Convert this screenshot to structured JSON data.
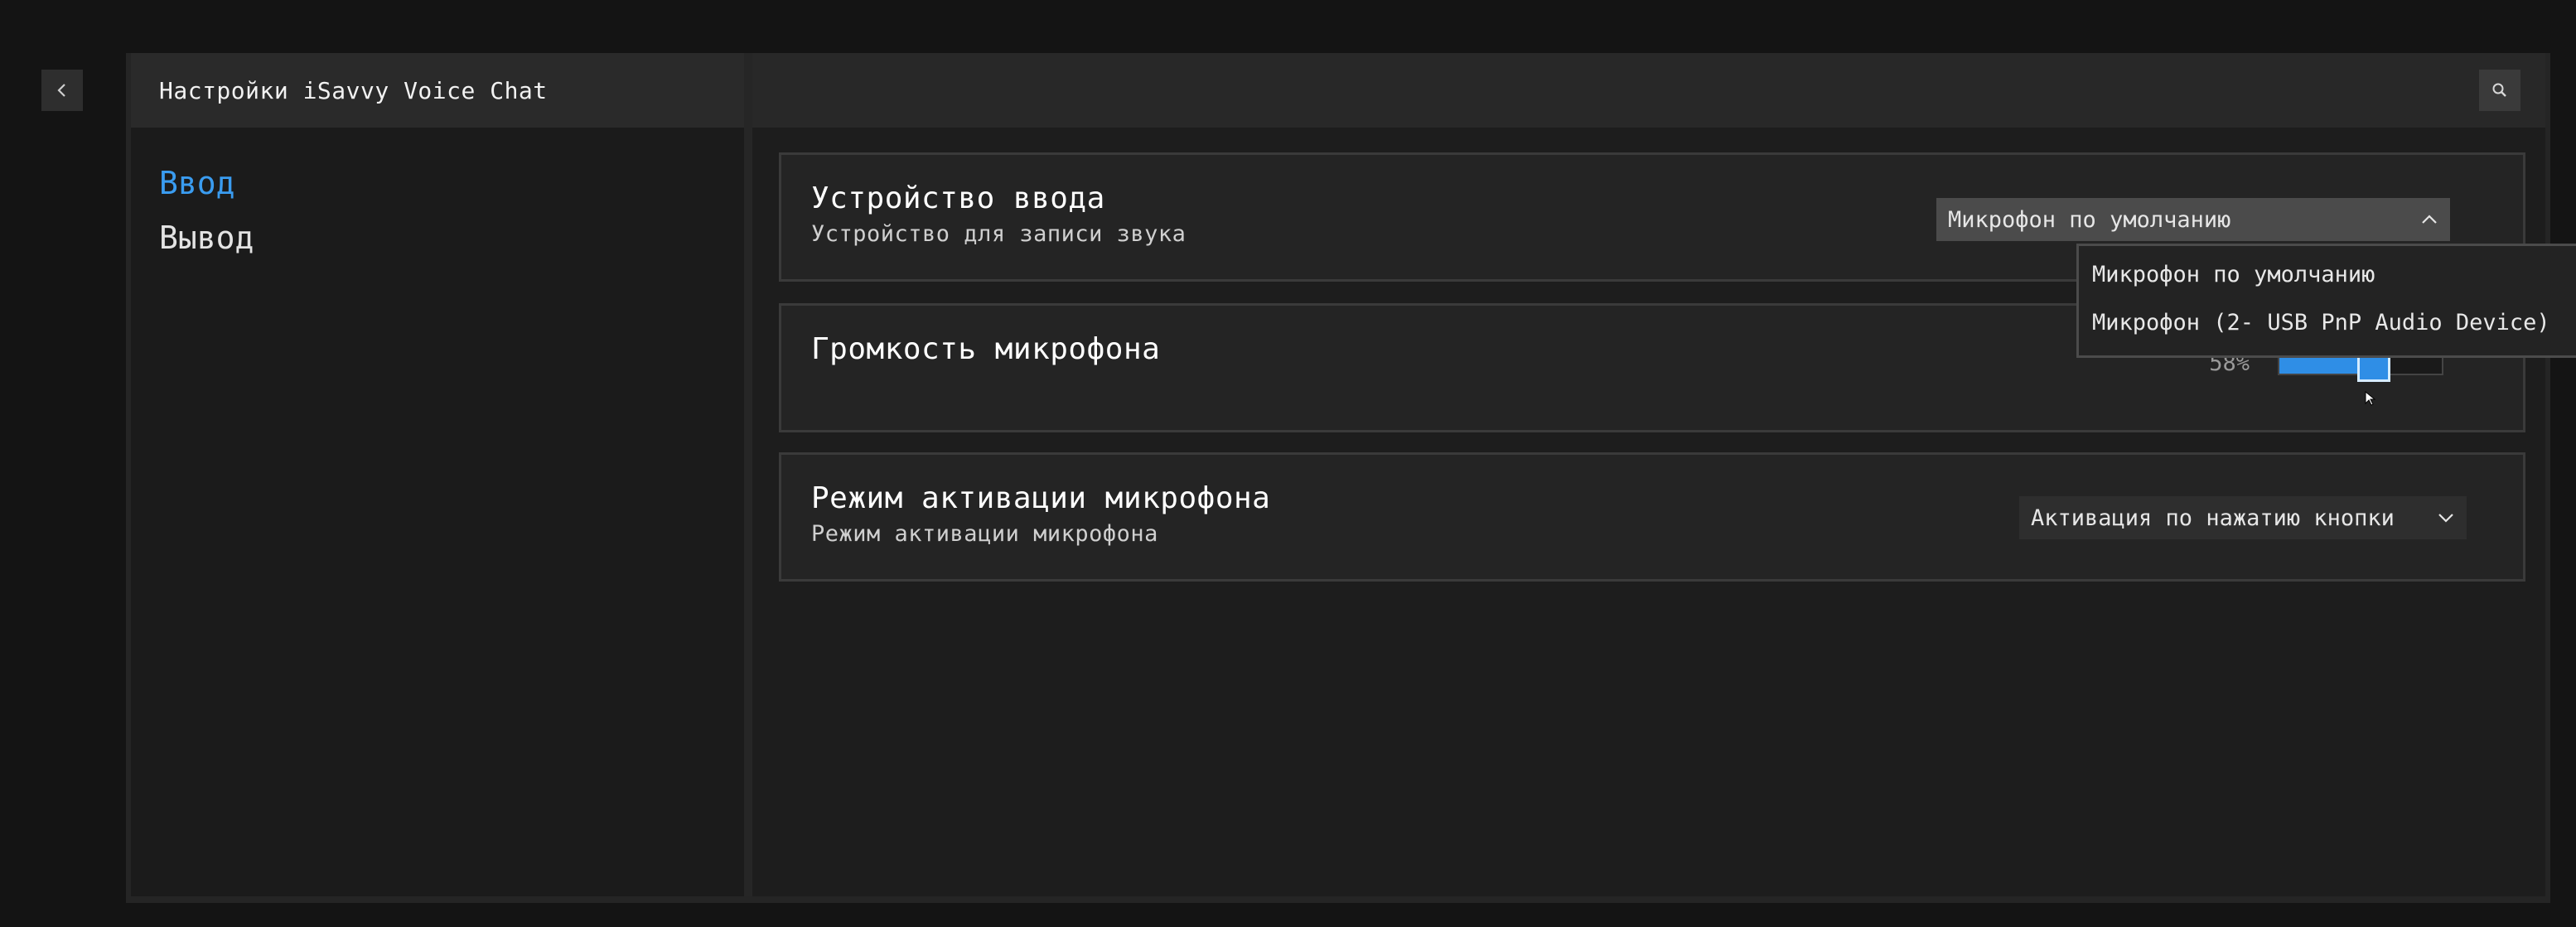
{
  "app": {
    "title": "Настройки iSavvy Voice Chat"
  },
  "icons": {
    "back": "chevron-left-icon",
    "search": "search-icon",
    "dropdown_open": "chevron-up-icon",
    "dropdown_closed": "chevron-down-icon"
  },
  "colors": {
    "accent": "#3a9cf0",
    "slider": "#2f8ee6",
    "background": "#141414"
  },
  "sidebar": {
    "items": [
      {
        "label": "Ввод",
        "active": true
      },
      {
        "label": "Вывод",
        "active": false
      }
    ]
  },
  "settings": {
    "input_device": {
      "title": "Устройство ввода",
      "description": "Устройство для записи звука",
      "selected": "Микрофон по умолчанию",
      "options": [
        "Микрофон по умолчанию",
        "Микрофон (2- USB PnP Audio Device)"
      ]
    },
    "mic_volume": {
      "title": "Громкость микрофона",
      "value_label": "58%",
      "value": 58
    },
    "activation_mode": {
      "title": "Режим активации микрофона",
      "description": "Режим активации микрофона",
      "selected": "Активация по нажатию кнопки"
    }
  }
}
